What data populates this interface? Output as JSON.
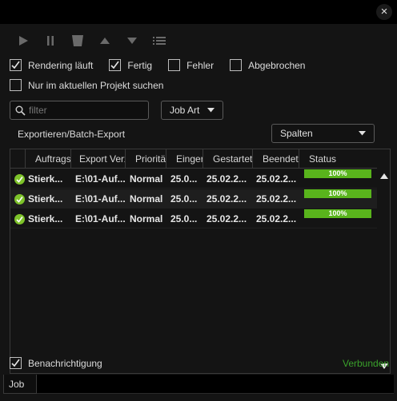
{
  "window": {
    "close_symbol": "×"
  },
  "toolbar": {
    "buttons": [
      "play-icon",
      "pause-icon",
      "trash-icon",
      "move-up-icon",
      "move-down-icon",
      "list-icon"
    ]
  },
  "filters": {
    "rendering": {
      "label": "Rendering läuft",
      "checked": true
    },
    "fertig": {
      "label": "Fertig",
      "checked": true
    },
    "fehler": {
      "label": "Fehler",
      "checked": false
    },
    "abgebrochen": {
      "label": "Abgebrochen",
      "checked": false
    },
    "current_project": {
      "label": "Nur im aktuellen Projekt suchen",
      "checked": false
    }
  },
  "search": {
    "placeholder": "filter",
    "value": ""
  },
  "job_type": {
    "label": "Job Art"
  },
  "section": {
    "title": "Exportieren/Batch-Export"
  },
  "columns_dropdown": {
    "label": "Spalten"
  },
  "table": {
    "headers": [
      "Auftrags",
      "Export Verz",
      "Prioritä",
      "Einger",
      "Gestartet",
      "Beendet",
      "Status"
    ],
    "rows": [
      {
        "name": "Stierk...",
        "path": "E:\\01-Auf...",
        "priority": "Normal",
        "submitted": "25.0...",
        "started": "25.02.2...",
        "ended": "25.02.2...",
        "progress": "100%"
      },
      {
        "name": "Stierk...",
        "path": "E:\\01-Auf...",
        "priority": "Normal",
        "submitted": "25.0...",
        "started": "25.02.2...",
        "ended": "25.02.2...",
        "progress": "100%"
      },
      {
        "name": "Stierk...",
        "path": "E:\\01-Auf...",
        "priority": "Normal",
        "submitted": "25.0...",
        "started": "25.02.2...",
        "ended": "25.02.2...",
        "progress": "100%"
      }
    ]
  },
  "footer": {
    "notification": {
      "label": "Benachrichtigung",
      "checked": true
    },
    "connection": "Verbunden"
  },
  "bottom": {
    "tab_label": "Job"
  },
  "colors": {
    "accent_green": "#59b41c",
    "status_green": "#3aa12b",
    "background": "#141414"
  }
}
